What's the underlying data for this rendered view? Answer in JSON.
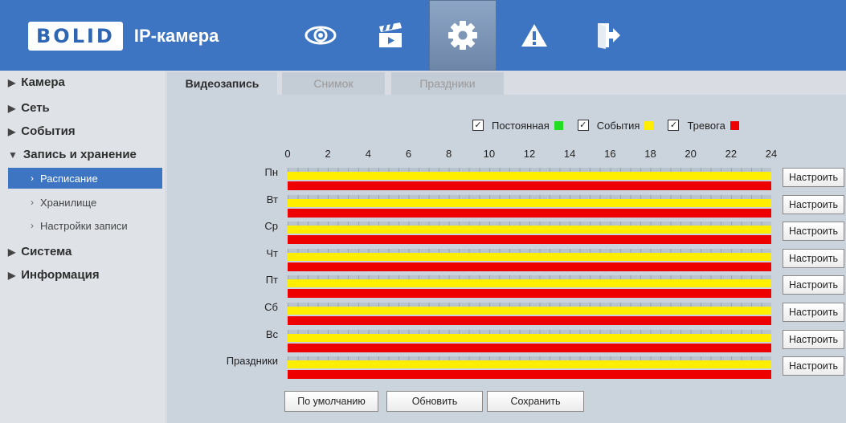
{
  "header": {
    "logo_text": "BOLID",
    "title": "IP-камера",
    "nav": [
      {
        "icon": "eye-icon"
      },
      {
        "icon": "clapperboard-icon"
      },
      {
        "icon": "gear-icon",
        "active": true
      },
      {
        "icon": "warning-icon"
      },
      {
        "icon": "logout-icon"
      }
    ]
  },
  "sidebar": {
    "items": [
      {
        "label": "Камера",
        "arrow": "▶"
      },
      {
        "label": "Сеть",
        "arrow": "▶"
      },
      {
        "label": "События",
        "arrow": "▶"
      },
      {
        "label": "Запись и хранение",
        "arrow": "▼"
      },
      {
        "label": "Система",
        "arrow": "▶"
      },
      {
        "label": "Информация",
        "arrow": "▶"
      }
    ],
    "subitems": [
      {
        "label": "Расписание",
        "active": true
      },
      {
        "label": "Хранилище"
      },
      {
        "label": "Настройки записи"
      }
    ],
    "chevron": "›"
  },
  "tabs": [
    {
      "label": "Видеозапись",
      "active": true
    },
    {
      "label": "Снимок"
    },
    {
      "label": "Праздники"
    }
  ],
  "legend": [
    {
      "label": "Постоянная",
      "color": "#22dd22",
      "checked": true
    },
    {
      "label": "События",
      "color": "#ffee00",
      "checked": true
    },
    {
      "label": "Тревога",
      "color": "#ee0000",
      "checked": true
    }
  ],
  "check_mark": "✓",
  "hours": [
    "0",
    "2",
    "4",
    "6",
    "8",
    "10",
    "12",
    "14",
    "16",
    "18",
    "20",
    "22",
    "24"
  ],
  "rows": [
    {
      "day": "Пн",
      "button": "Настроить"
    },
    {
      "day": "Вт",
      "button": "Настроить"
    },
    {
      "day": "Ср",
      "button": "Настроить"
    },
    {
      "day": "Чт",
      "button": "Настроить"
    },
    {
      "day": "Пт",
      "button": "Настроить"
    },
    {
      "day": "Сб",
      "button": "Настроить"
    },
    {
      "day": "Вс",
      "button": "Настроить"
    },
    {
      "day": "Праздники",
      "button": "Настроить"
    }
  ],
  "actions": {
    "default": "По умолчанию",
    "refresh": "Обновить",
    "save": "Сохранить"
  },
  "colors": {
    "header_bg": "#3d75c2",
    "accent": "#3d75c2",
    "events": "#ffee00",
    "alarm": "#ee0000",
    "continuous": "#22dd22"
  }
}
